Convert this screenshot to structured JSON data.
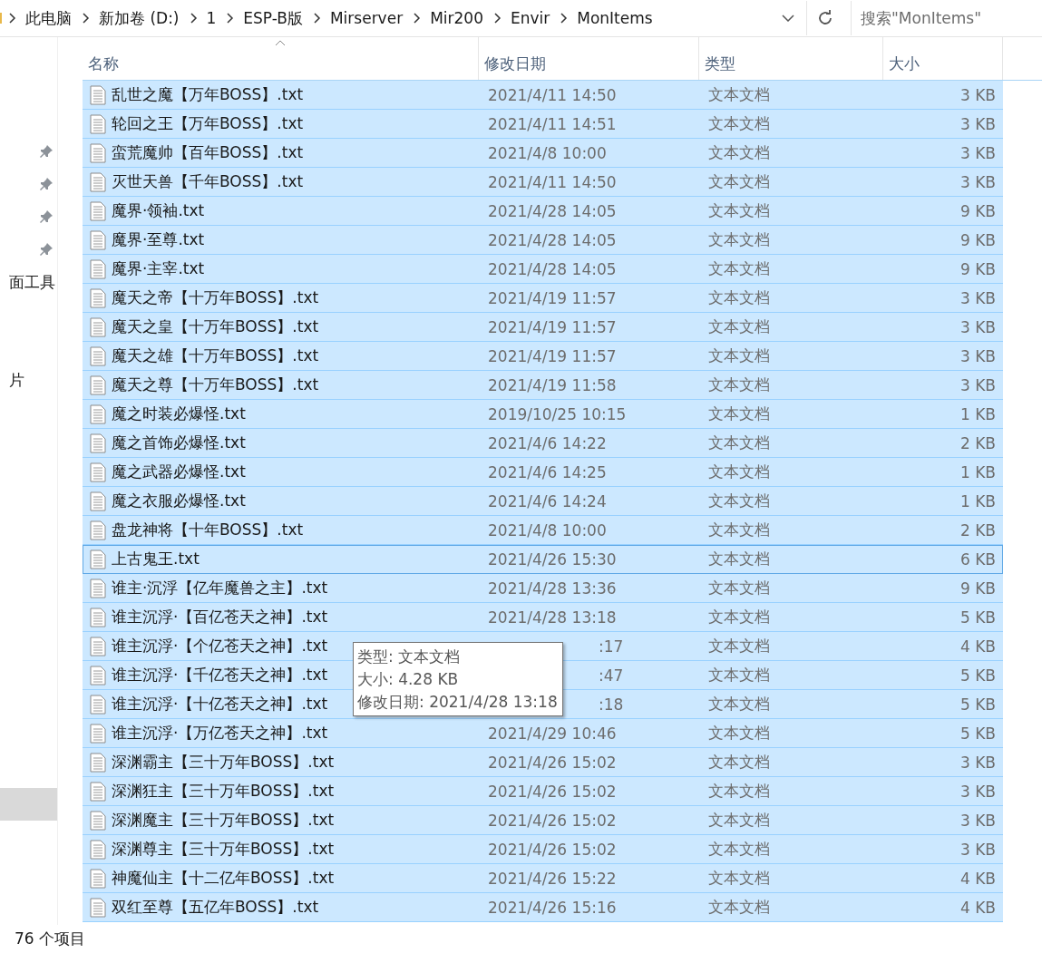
{
  "breadcrumb": [
    "此电脑",
    "新加卷 (D:)",
    "1",
    "ESP-B版",
    "Mirserver",
    "Mir200",
    "Envir",
    "MonItems"
  ],
  "search": {
    "placeholder": "搜索\"MonItems\""
  },
  "nav_pane": {
    "items": [
      {
        "kind": "pinned"
      },
      {
        "kind": "pinned"
      },
      {
        "kind": "pinned"
      },
      {
        "kind": "pinned"
      },
      {
        "kind": "label",
        "label": "面工具"
      },
      {
        "kind": "label",
        "label": "片"
      },
      {
        "kind": "blank",
        "selected": true
      }
    ]
  },
  "table": {
    "columns": [
      {
        "label": "名称",
        "sorted": true
      },
      {
        "label": "修改日期",
        "sorted": false
      },
      {
        "label": "类型",
        "sorted": false
      },
      {
        "label": "大小",
        "sorted": false
      }
    ],
    "rows": [
      {
        "name": "乱世之魔【万年BOSS】.txt",
        "date": "2021/4/11 14:50",
        "type": "文本文档",
        "size": "3 KB",
        "selected": true,
        "focused": false
      },
      {
        "name": "轮回之王【万年BOSS】.txt",
        "date": "2021/4/11 14:51",
        "type": "文本文档",
        "size": "3 KB",
        "selected": true,
        "focused": false
      },
      {
        "name": "蛮荒魔帅【百年BOSS】.txt",
        "date": "2021/4/8 10:00",
        "type": "文本文档",
        "size": "3 KB",
        "selected": true,
        "focused": false
      },
      {
        "name": "灭世天兽【千年BOSS】.txt",
        "date": "2021/4/11 14:50",
        "type": "文本文档",
        "size": "3 KB",
        "selected": true,
        "focused": false
      },
      {
        "name": "魔界·领袖.txt",
        "date": "2021/4/28 14:05",
        "type": "文本文档",
        "size": "9 KB",
        "selected": true,
        "focused": false
      },
      {
        "name": "魔界·至尊.txt",
        "date": "2021/4/28 14:05",
        "type": "文本文档",
        "size": "9 KB",
        "selected": true,
        "focused": false
      },
      {
        "name": "魔界·主宰.txt",
        "date": "2021/4/28 14:05",
        "type": "文本文档",
        "size": "9 KB",
        "selected": true,
        "focused": false
      },
      {
        "name": "魔天之帝【十万年BOSS】.txt",
        "date": "2021/4/19 11:57",
        "type": "文本文档",
        "size": "3 KB",
        "selected": true,
        "focused": false
      },
      {
        "name": "魔天之皇【十万年BOSS】.txt",
        "date": "2021/4/19 11:57",
        "type": "文本文档",
        "size": "3 KB",
        "selected": true,
        "focused": false
      },
      {
        "name": "魔天之雄【十万年BOSS】.txt",
        "date": "2021/4/19 11:57",
        "type": "文本文档",
        "size": "3 KB",
        "selected": true,
        "focused": false
      },
      {
        "name": "魔天之尊【十万年BOSS】.txt",
        "date": "2021/4/19 11:58",
        "type": "文本文档",
        "size": "3 KB",
        "selected": true,
        "focused": false
      },
      {
        "name": "魔之时装必爆怪.txt",
        "date": "2019/10/25 10:15",
        "type": "文本文档",
        "size": "1 KB",
        "selected": true,
        "focused": false
      },
      {
        "name": "魔之首饰必爆怪.txt",
        "date": "2021/4/6 14:22",
        "type": "文本文档",
        "size": "2 KB",
        "selected": true,
        "focused": false
      },
      {
        "name": "魔之武器必爆怪.txt",
        "date": "2021/4/6 14:25",
        "type": "文本文档",
        "size": "1 KB",
        "selected": true,
        "focused": false
      },
      {
        "name": "魔之衣服必爆怪.txt",
        "date": "2021/4/6 14:24",
        "type": "文本文档",
        "size": "1 KB",
        "selected": true,
        "focused": false
      },
      {
        "name": "盘龙神将【十年BOSS】.txt",
        "date": "2021/4/8 10:00",
        "type": "文本文档",
        "size": "2 KB",
        "selected": true,
        "focused": false
      },
      {
        "name": "上古鬼王.txt",
        "date": "2021/4/26 15:30",
        "type": "文本文档",
        "size": "6 KB",
        "selected": true,
        "focused": true
      },
      {
        "name": "谁主·沉浮【亿年魔兽之主】.txt",
        "date": "2021/4/28 13:36",
        "type": "文本文档",
        "size": "9 KB",
        "selected": true,
        "focused": false
      },
      {
        "name": "谁主沉浮·【百亿苍天之神】.txt",
        "date": "2021/4/28 13:18",
        "type": "文本文档",
        "size": "5 KB",
        "selected": true,
        "focused": false
      },
      {
        "name": "谁主沉浮·【个亿苍天之神】.txt",
        "date": ":17",
        "date_covered": true,
        "type": "文本文档",
        "size": "4 KB",
        "selected": true,
        "focused": false
      },
      {
        "name": "谁主沉浮·【千亿苍天之神】.txt",
        "date": ":47",
        "date_covered": true,
        "type": "文本文档",
        "size": "5 KB",
        "selected": true,
        "focused": false
      },
      {
        "name": "谁主沉浮·【十亿苍天之神】.txt",
        "date": ":18",
        "date_covered": true,
        "type": "文本文档",
        "size": "5 KB",
        "selected": true,
        "focused": false
      },
      {
        "name": "谁主沉浮·【万亿苍天之神】.txt",
        "date": "2021/4/29 10:46",
        "type": "文本文档",
        "size": "5 KB",
        "selected": true,
        "focused": false
      },
      {
        "name": "深渊霸主【三十万年BOSS】.txt",
        "date": "2021/4/26 15:02",
        "type": "文本文档",
        "size": "3 KB",
        "selected": true,
        "focused": false
      },
      {
        "name": "深渊狂主【三十万年BOSS】.txt",
        "date": "2021/4/26 15:02",
        "type": "文本文档",
        "size": "3 KB",
        "selected": true,
        "focused": false
      },
      {
        "name": "深渊魔主【三十万年BOSS】.txt",
        "date": "2021/4/26 15:02",
        "type": "文本文档",
        "size": "3 KB",
        "selected": true,
        "focused": false
      },
      {
        "name": "深渊尊主【三十万年BOSS】.txt",
        "date": "2021/4/26 15:02",
        "type": "文本文档",
        "size": "3 KB",
        "selected": true,
        "focused": false
      },
      {
        "name": "神魔仙主【十二亿年BOSS】.txt",
        "date": "2021/4/26 15:22",
        "type": "文本文档",
        "size": "4 KB",
        "selected": true,
        "focused": false
      },
      {
        "name": "双红至尊【五亿年BOSS】.txt",
        "date": "2021/4/26 15:16",
        "type": "文本文档",
        "size": "4 KB",
        "selected": true,
        "focused": false
      }
    ]
  },
  "tooltip": {
    "lines": [
      "类型: 文本文档",
      "大小: 4.28 KB",
      "修改日期: 2021/4/28 13:18"
    ]
  },
  "status_bar": {
    "text": "76 个项目"
  }
}
